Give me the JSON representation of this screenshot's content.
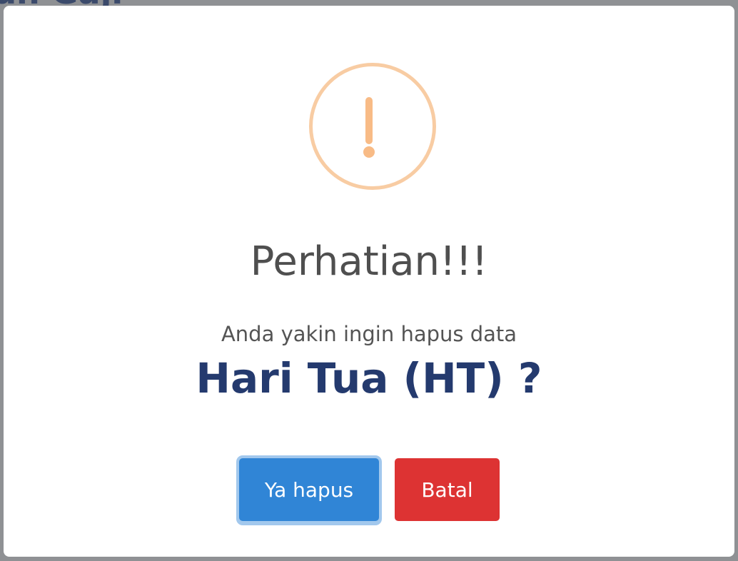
{
  "background": {
    "heading_fragment": "an Gaji"
  },
  "dialog": {
    "icon": "warning-exclamation-icon",
    "icon_color": "#f8bb86",
    "title": "Perhatian!!!",
    "message": "Anda yakin ingin hapus data",
    "subject": "Hari Tua (HT) ?",
    "confirm_label": "Ya hapus",
    "cancel_label": "Batal",
    "confirm_color": "#3085d6",
    "cancel_color": "#dd3333",
    "subject_color": "#243a6e"
  }
}
